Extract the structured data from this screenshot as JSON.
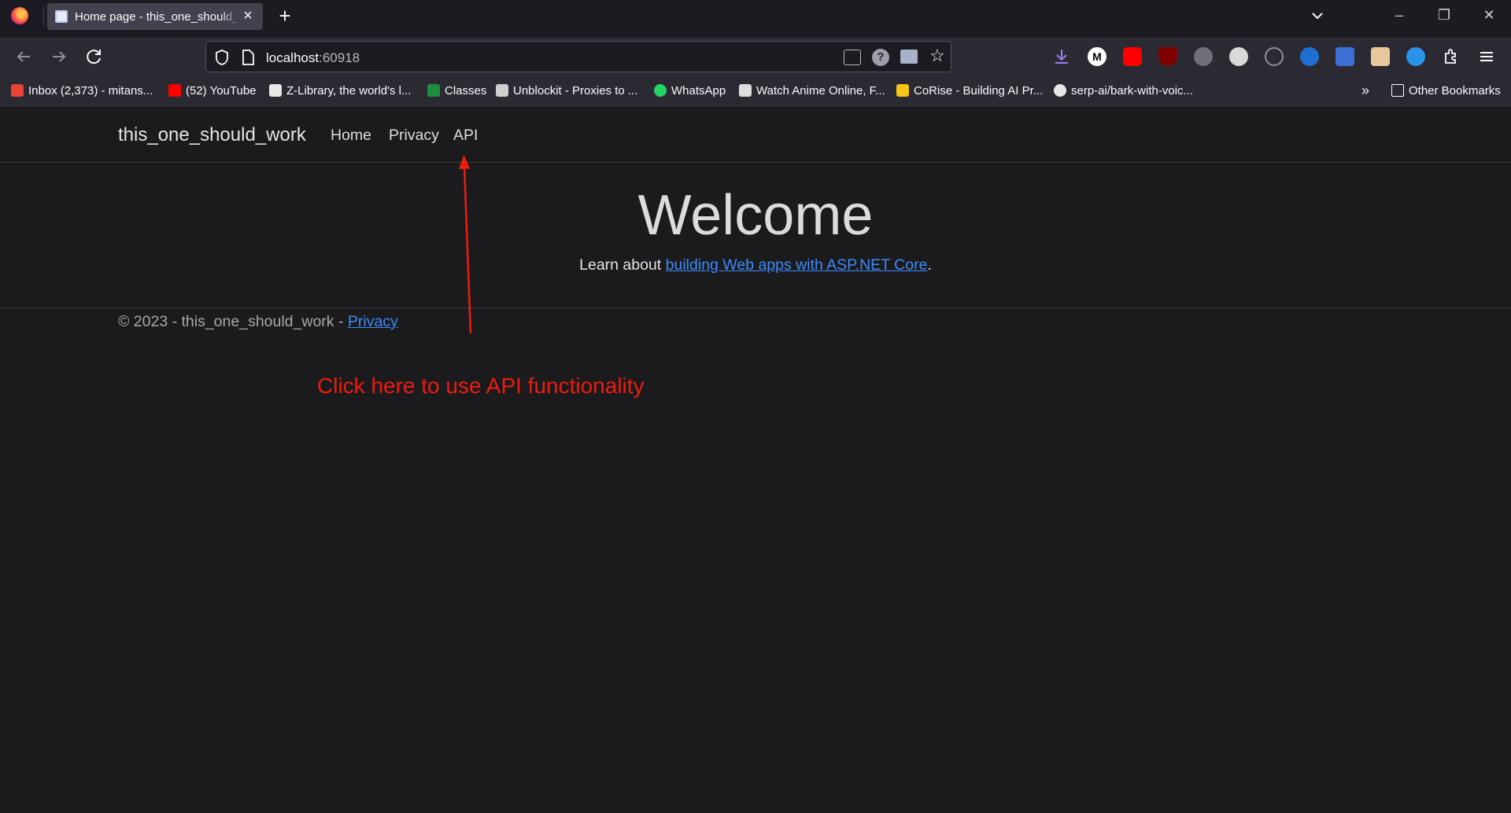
{
  "browser": {
    "tab": {
      "title": "Home page - this_one_should_work"
    },
    "url": {
      "host": "localhost",
      "port": ":60918"
    },
    "bookmarks": [
      {
        "label": "Inbox (2,373) - mitans...",
        "icon": "gmail-icon",
        "color": "#ea4335"
      },
      {
        "label": "(52) YouTube",
        "icon": "youtube-icon",
        "color": "#ff0000"
      },
      {
        "label": "Z-Library, the world's l...",
        "icon": "zlibrary-icon",
        "color": "#e8e8e8"
      },
      {
        "label": "Classes",
        "icon": "classroom-icon",
        "color": "#1e8e3e"
      },
      {
        "label": "Unblockit - Proxies to ...",
        "icon": "unblockit-icon",
        "color": "#cfcfcf"
      },
      {
        "label": "WhatsApp",
        "icon": "whatsapp-icon",
        "color": "#25d366"
      },
      {
        "label": "Watch Anime Online, F...",
        "icon": "anime-icon",
        "color": "#dddddd"
      },
      {
        "label": "CoRise - Building AI Pr...",
        "icon": "corise-icon",
        "color": "#f5c518"
      },
      {
        "label": "serp-ai/bark-with-voic...",
        "icon": "github-icon",
        "color": "#e8e8e8"
      }
    ],
    "other_bookmarks": "Other Bookmarks"
  },
  "site": {
    "brand": "this_one_should_work",
    "nav": [
      "Home",
      "Privacy",
      "API"
    ],
    "welcome": "Welcome",
    "learn_prefix": "Learn about ",
    "learn_link": "building Web apps with ASP.NET Core",
    "learn_suffix": ".",
    "footer_text": "© 2023 - this_one_should_work - ",
    "footer_link": "Privacy"
  },
  "annotation": {
    "text": "Click here to use API functionality",
    "color": "#ee1c0f"
  }
}
